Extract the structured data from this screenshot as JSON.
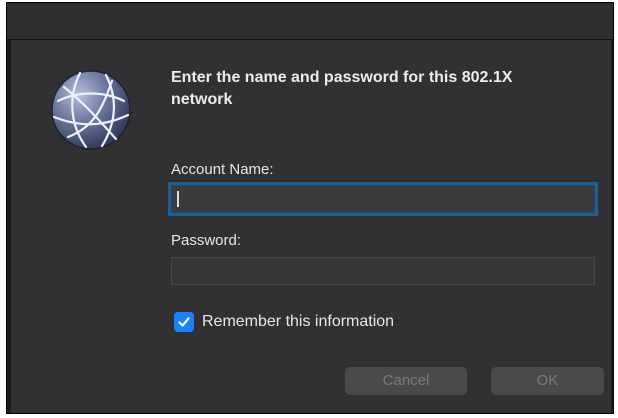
{
  "dialog": {
    "heading": "Enter the name and password for this 802.1X network",
    "account_label": "Account Name:",
    "account_value": "",
    "password_label": "Password:",
    "password_value": "",
    "remember_label": "Remember this information",
    "remember_checked": true,
    "cancel_label": "Cancel",
    "ok_label": "OK"
  },
  "icons": {
    "network": "globe-icon",
    "check": "checkmark-icon"
  },
  "colors": {
    "focus_ring": "#1f5f8e",
    "checkbox": "#1a82fb"
  }
}
